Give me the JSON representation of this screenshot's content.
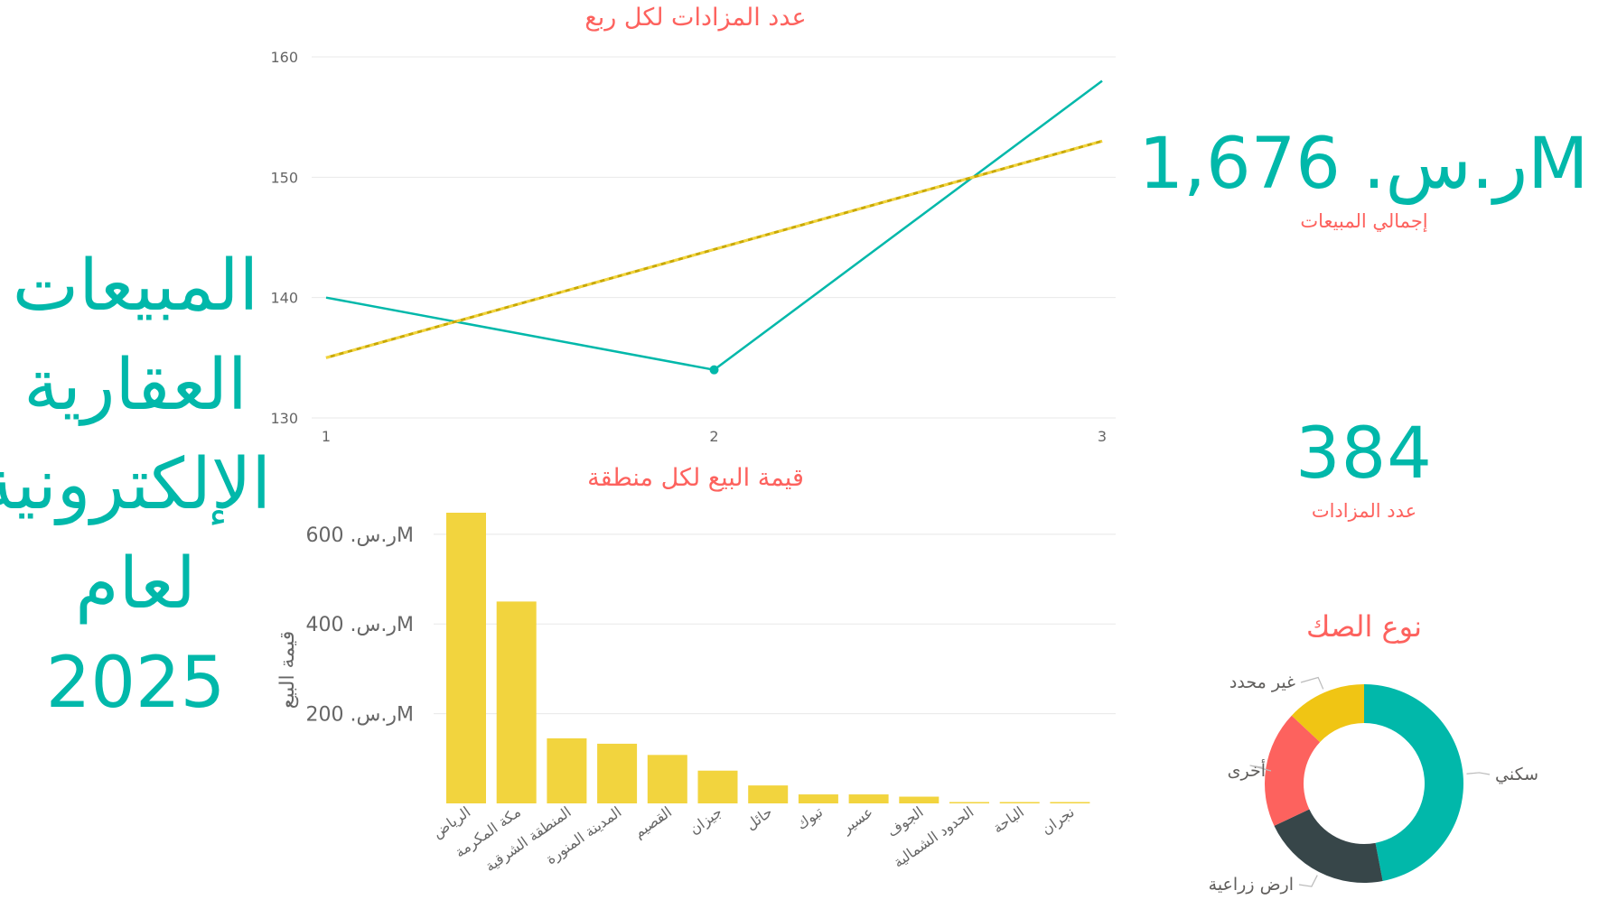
{
  "title_lines": [
    "المبيعات",
    "العقارية",
    "الإلكترونية",
    "لعام",
    "2025"
  ],
  "kpis": {
    "total_sales": {
      "value": "ر.س. 1,676M",
      "label": "إجمالي المبيعات"
    },
    "auctions_count": {
      "value": "384",
      "label": "عدد المزادات"
    }
  },
  "colors": {
    "teal": "#01b8aa",
    "yellow": "#f2d43e",
    "coral": "#fd625e",
    "dark": "#374649",
    "gold": "#f0c514",
    "axis_text": "#666666"
  },
  "chart_data": [
    {
      "type": "line",
      "title": "عدد المزادات لكل ربع",
      "x": [
        1,
        2,
        3
      ],
      "xticks": [
        "1",
        "2",
        "3"
      ],
      "ylim": [
        130,
        160
      ],
      "yticks": [
        130,
        140,
        150,
        160
      ],
      "grid": true,
      "series": [
        {
          "values": [
            140,
            134,
            158
          ],
          "color": "#01b8aa",
          "style": "solid"
        },
        {
          "values": [
            135,
            144,
            153
          ],
          "color": "#f2d43e",
          "style": "dashed-trend"
        }
      ]
    },
    {
      "type": "bar",
      "title": "قيمة البيع لكل منطقة",
      "ylabel": "قيمة البيع",
      "ylim": [
        0,
        650
      ],
      "yticks": [
        200,
        400,
        600
      ],
      "yticklabels": [
        "ر.س. 200M",
        "ر.س. 400M",
        "ر.س. 600M"
      ],
      "grid": true,
      "categories": [
        "الرياض",
        "مكة المكرمة",
        "المنطقة الشرقية",
        "المدينة المنورة",
        "القصيم",
        "جيزان",
        "حائل",
        "تبوك",
        "عسير",
        "الجوف",
        "الحدود الشمالية",
        "الباحة",
        "نجران"
      ],
      "values": [
        648,
        450,
        145,
        133,
        108,
        73,
        40,
        20,
        20,
        15,
        3,
        3,
        3
      ],
      "color": "#f2d43e"
    },
    {
      "type": "pie",
      "subtype": "donut",
      "title": "نوع الصك",
      "categories": [
        "سكني",
        "ارض زراعية",
        "أخرى",
        "غير محدد"
      ],
      "values": [
        47,
        21,
        19,
        13
      ],
      "colors": [
        "#01b8aa",
        "#374649",
        "#fd625e",
        "#f0c514"
      ]
    }
  ]
}
